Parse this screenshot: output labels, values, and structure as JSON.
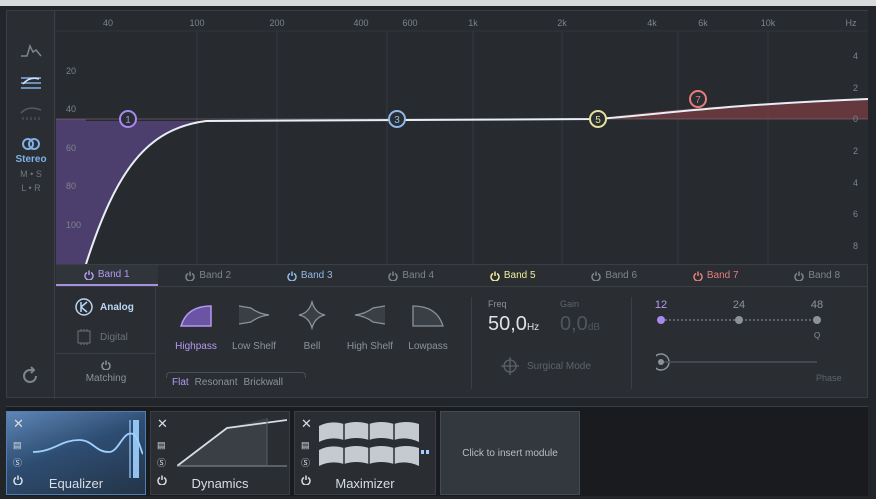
{
  "freq_axis": [
    "40",
    "100",
    "200",
    "400",
    "600",
    "1k",
    "2k",
    "4k",
    "6k",
    "10k",
    "Hz"
  ],
  "db_left": [
    "20",
    "40",
    "60",
    "80",
    "100"
  ],
  "db_right": [
    "4",
    "2",
    "0",
    "2",
    "4",
    "6",
    "8"
  ],
  "sidebar": {
    "stereo": "Stereo",
    "ms": "M • S",
    "lr": "L • R"
  },
  "nodes": [
    {
      "label": "1",
      "color": "#a889f0"
    },
    {
      "label": "3",
      "color": "#8fb8ea"
    },
    {
      "label": "5",
      "color": "#e6e09a"
    },
    {
      "label": "7",
      "color": "#e57d7d"
    }
  ],
  "bands": [
    {
      "label": "Band 1",
      "color": "#b499f0",
      "active": true
    },
    {
      "label": "Band 2",
      "color": "#7c848d",
      "active": false
    },
    {
      "label": "Band 3",
      "color": "#8fb8ea",
      "active": false
    },
    {
      "label": "Band 4",
      "color": "#7c848d",
      "active": false
    },
    {
      "label": "Band 5",
      "color": "#f1ed9a",
      "active": false
    },
    {
      "label": "Band 6",
      "color": "#7c848d",
      "active": false
    },
    {
      "label": "Band 7",
      "color": "#e57d7d",
      "active": false
    },
    {
      "label": "Band 8",
      "color": "#7c848d",
      "active": false
    }
  ],
  "mode": {
    "analog": "Analog",
    "digital": "Digital",
    "matching": "Matching"
  },
  "shapes": [
    {
      "label": "Highpass",
      "active": true
    },
    {
      "label": "Low Shelf",
      "active": false
    },
    {
      "label": "Bell",
      "active": false
    },
    {
      "label": "High Shelf",
      "active": false
    },
    {
      "label": "Lowpass",
      "active": false
    }
  ],
  "slopes": [
    "Flat",
    "Resonant",
    "Brickwall"
  ],
  "freq": {
    "label": "Freq",
    "value": "50,0",
    "unit": "Hz"
  },
  "gain": {
    "label": "Gain",
    "value": "0,0",
    "unit": "dB"
  },
  "surgical": "Surgical Mode",
  "slope_values": [
    "12",
    "24",
    "48"
  ],
  "q_label": "Q",
  "phase_label": "Phase",
  "modules": [
    {
      "name": "Equalizer",
      "active": true
    },
    {
      "name": "Dynamics",
      "active": false
    },
    {
      "name": "Maximizer",
      "active": false
    }
  ],
  "insert_label": "Click to insert module"
}
